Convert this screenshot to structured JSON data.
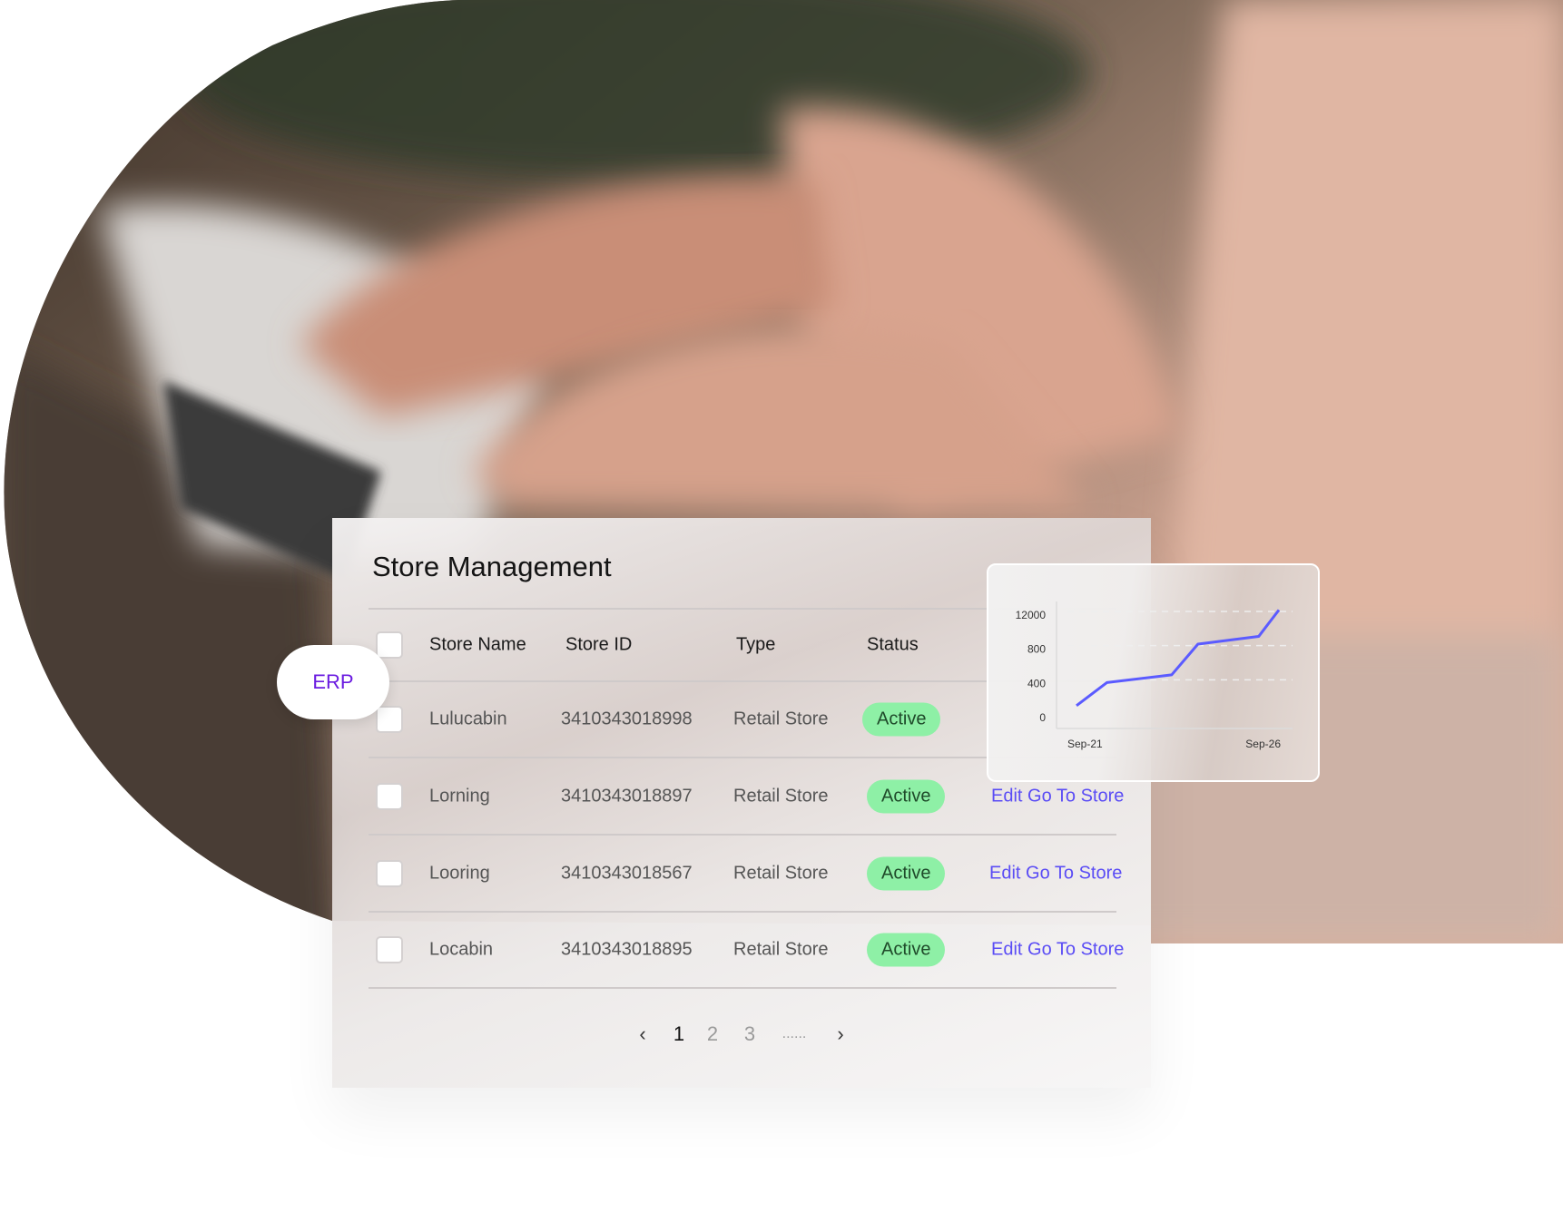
{
  "badge": {
    "label": "ERP"
  },
  "card": {
    "title": "Store Management",
    "columns": [
      "Store Name",
      "Store ID",
      "Type",
      "Status"
    ],
    "rows": [
      {
        "name": "Lulucabin",
        "id": "3410343018998",
        "type": "Retail Store",
        "status": "Active",
        "action": ""
      },
      {
        "name": "Lorning",
        "id": "3410343018897",
        "type": "Retail Store",
        "status": "Active",
        "action": "Edit Go To Store"
      },
      {
        "name": "Looring",
        "id": "3410343018567",
        "type": "Retail Store",
        "status": "Active",
        "action": "Edit Go To Store"
      },
      {
        "name": "Locabin",
        "id": "3410343018895",
        "type": "Retail Store",
        "status": "Active",
        "action": "Edit Go To Store"
      }
    ],
    "pagination": {
      "prev": "‹",
      "pages": [
        "1",
        "2",
        "3"
      ],
      "current": "1",
      "ellipsis": "......",
      "next": "›"
    }
  },
  "colors": {
    "accent": "#5a4cf5",
    "active": "#8ef0a6",
    "line": "#5b5bff",
    "badge_text": "#6a1be0"
  },
  "chart_data": {
    "type": "line",
    "x": [
      21,
      21.75,
      23.35,
      24,
      25.5,
      26
    ],
    "values": [
      140,
      410,
      500,
      860,
      950,
      1260
    ],
    "x_tick_labels": [
      "Sep-21",
      "Sep-26"
    ],
    "y_ticks": [
      0,
      400,
      800,
      1200
    ],
    "y_tick_labels": [
      "0",
      "400",
      "800",
      "12000"
    ],
    "ylim": [
      0,
      1200
    ],
    "grid": "dashed horizontal"
  }
}
